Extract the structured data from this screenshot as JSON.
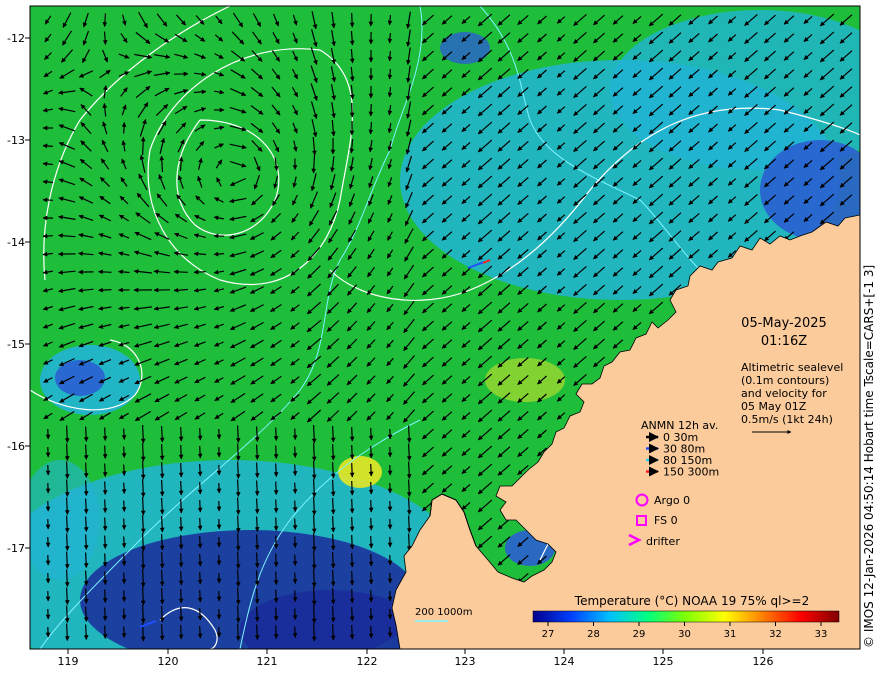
{
  "map": {
    "lon_ticks": [
      "119",
      "120",
      "121",
      "122",
      "123",
      "124",
      "125",
      "126"
    ],
    "lat_ticks": [
      "-12",
      "-13",
      "-14",
      "-15",
      "-16",
      "-17"
    ],
    "colors": {
      "land": "#fbcb9c",
      "sea_base": "#1fbe3a",
      "sea_cool": "#22b4d6",
      "sea_cold": "#2a5fd0",
      "sea_coldest": "#1a2c9a",
      "warm_patch": "#e6e628",
      "contour": "#ffffff",
      "isobath": "#7ff4ff",
      "arrow": "#000000"
    }
  },
  "info": {
    "date": "05-May-2025",
    "time": "01:16Z",
    "altimetry_lines": [
      "Altimetric sealevel",
      "(0.1m contours)",
      "and velocity for",
      "05 May 01Z",
      "0.5m/s (1kt 24h)"
    ]
  },
  "legend": {
    "title": "ANMN 12h av.",
    "depth_bins": [
      {
        "label": "0 30m",
        "color": "#000000"
      },
      {
        "label": "30 80m",
        "color": "#1e50ff"
      },
      {
        "label": "80 150m",
        "color": "#20d0f0"
      },
      {
        "label": "150 300m",
        "color": "#ff2020"
      }
    ],
    "argo": "Argo 0",
    "fs": "FS 0",
    "drifter": "drifter",
    "marker_color": "#ff00ff"
  },
  "isobath_legend": "200  1000m",
  "colorbar": {
    "title": "Temperature (°C) NOAA 19 75% ql>=2",
    "ticks": [
      "27",
      "28",
      "29",
      "30",
      "31",
      "32",
      "33"
    ],
    "stops": [
      "#00008b",
      "#0040ff",
      "#00c0ff",
      "#00ff80",
      "#80ff00",
      "#ffff00",
      "#ff8000",
      "#ff0000",
      "#800000"
    ]
  },
  "side_caption": "© IMOS 12-Jan-2026 04:50:14 Hobart time Tscale=CARS+[-1 3]"
}
